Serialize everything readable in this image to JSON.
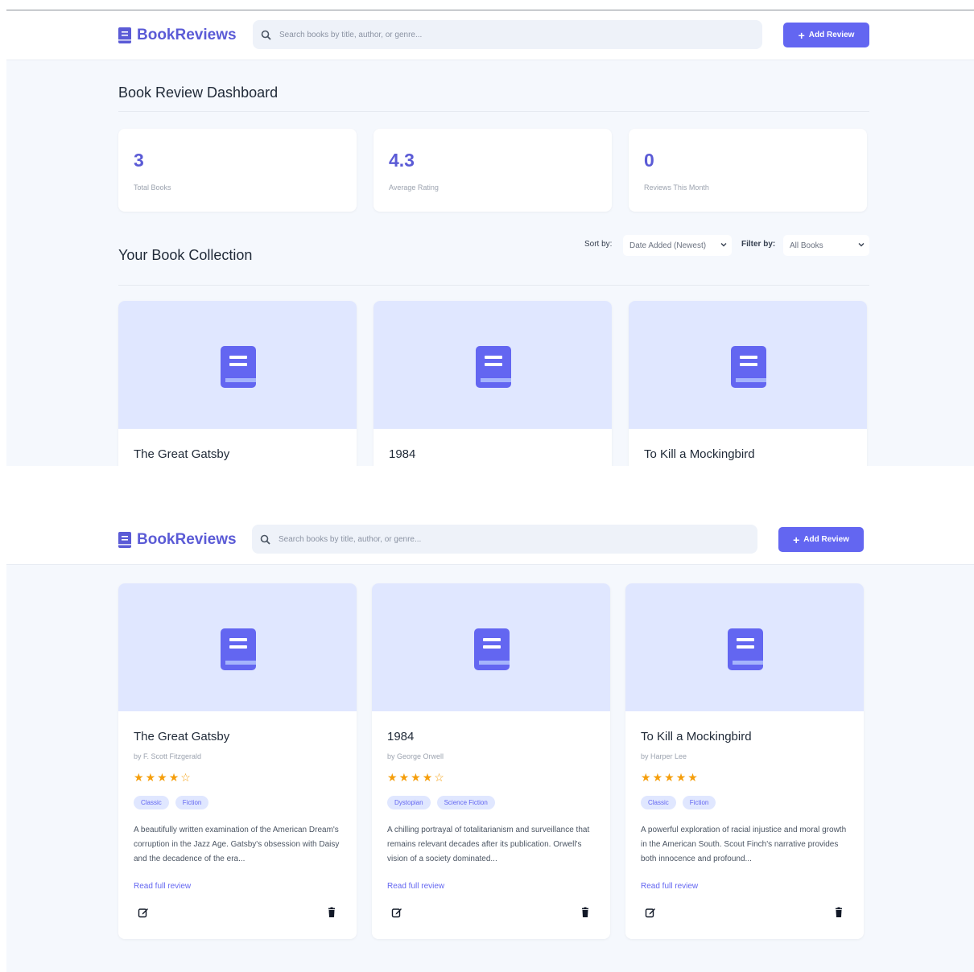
{
  "app": {
    "name": "BookReviews",
    "search_placeholder": "Search books by title, author, or genre...",
    "add_button": "Add Review",
    "accent": "#6366f1"
  },
  "dashboard": {
    "title": "Book Review Dashboard",
    "stats": [
      {
        "value": "3",
        "label": "Total Books"
      },
      {
        "value": "4.3",
        "label": "Average Rating"
      },
      {
        "value": "0",
        "label": "Reviews This Month"
      }
    ]
  },
  "collection": {
    "title": "Your Book Collection",
    "sort_label": "Sort by:",
    "sort_value": "Date Added (Newest)",
    "filter_label": "Filter by:",
    "filter_value": "All Books"
  },
  "books": [
    {
      "title": "The Great Gatsby",
      "author": "by F. Scott Fitzgerald",
      "rating": 4,
      "tags": [
        "Classic",
        "Fiction"
      ],
      "description": "A beautifully written examination of the American Dream's corruption in the Jazz Age. Gatsby's obsession with Daisy and the decadence of the era...",
      "read_more": "Read full review"
    },
    {
      "title": "1984",
      "author": "by George Orwell",
      "rating": 4,
      "tags": [
        "Dystopian",
        "Science Fiction"
      ],
      "description": "A chilling portrayal of totalitarianism and surveillance that remains relevant decades after its publication. Orwell's vision of a society dominated...",
      "read_more": "Read full review"
    },
    {
      "title": "To Kill a Mockingbird",
      "author": "by Harper Lee",
      "rating": 5,
      "tags": [
        "Classic",
        "Fiction"
      ],
      "description": "A powerful exploration of racial injustice and moral growth in the American South. Scout Finch's narrative provides both innocence and profound...",
      "read_more": "Read full review"
    }
  ],
  "icons": {
    "logo": "book-icon",
    "search": "search-icon",
    "add": "plus-icon",
    "cover": "book-icon",
    "edit": "edit-icon",
    "delete": "trash-icon",
    "sort": "chevron-down-icon"
  }
}
